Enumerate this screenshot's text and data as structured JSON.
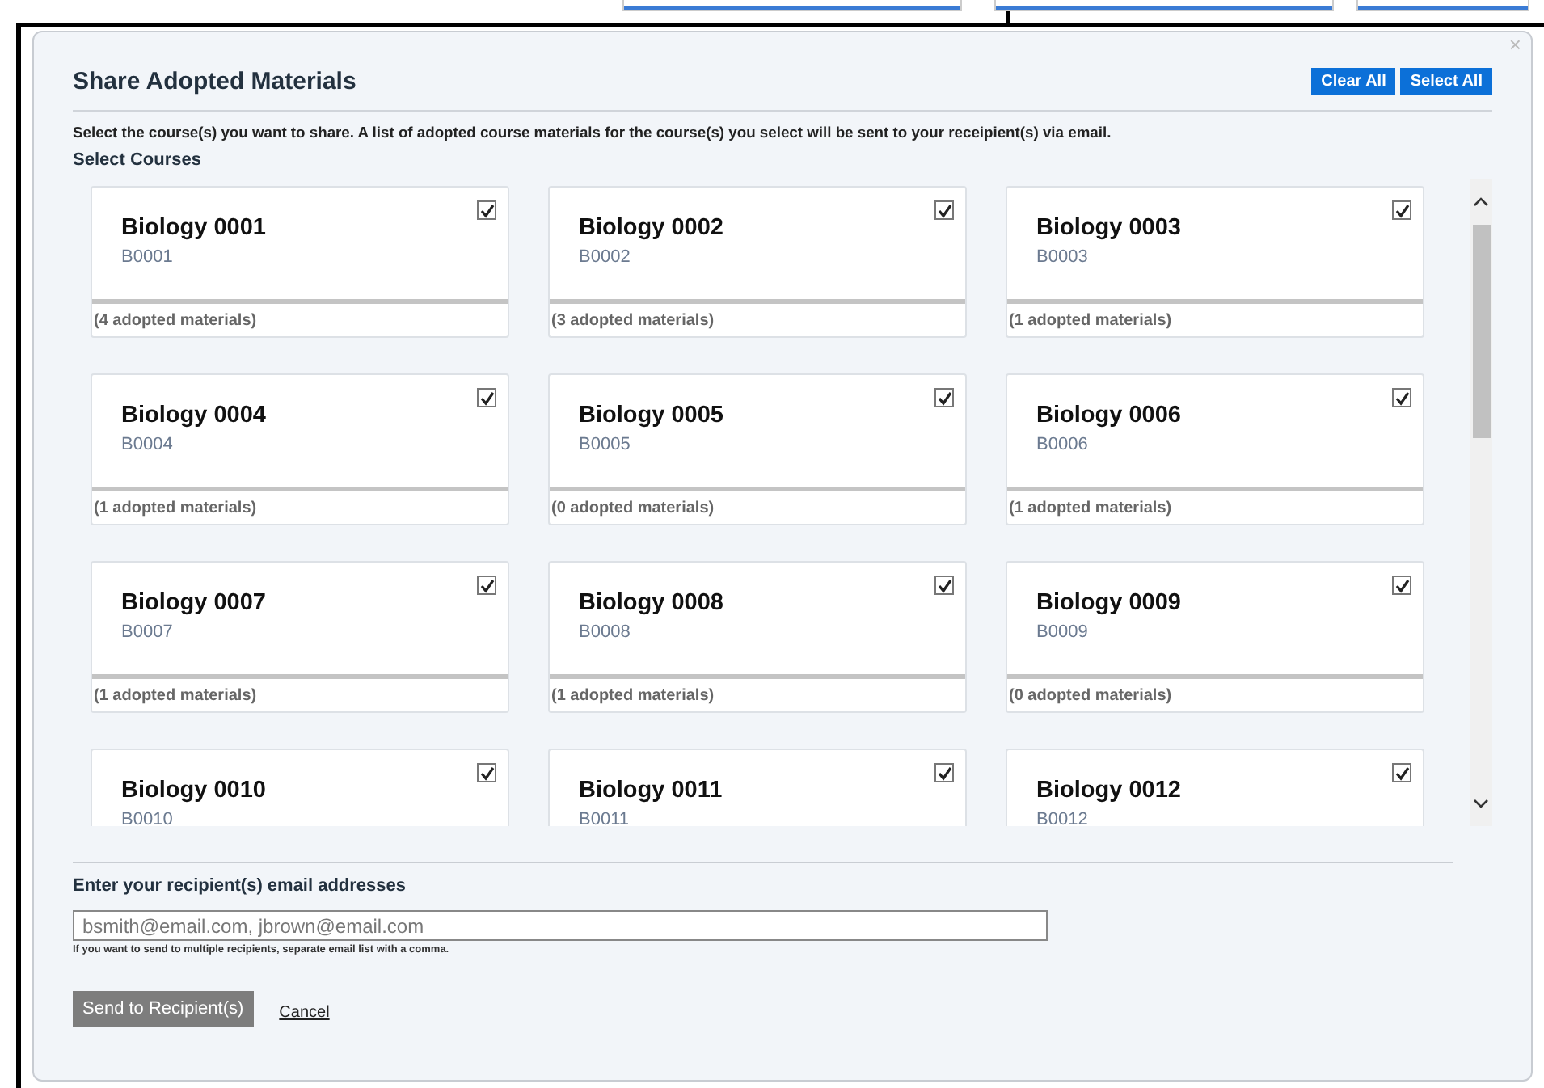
{
  "dialog": {
    "title": "Share Adopted Materials",
    "close": "×",
    "actions": [
      {
        "label": "Clear All"
      },
      {
        "label": "Select All"
      }
    ],
    "instructions": "Select the course(s) you want to share. A list of adopted course materials for the course(s) you select will be sent to your receipient(s) via email.",
    "section_label": "Select Courses",
    "courses": [
      {
        "title": "Biology 0001",
        "code": "B0001",
        "checked": true,
        "materials": "(4 adopted materials)"
      },
      {
        "title": "Biology 0002",
        "code": "B0002",
        "checked": true,
        "materials": "(3 adopted materials)"
      },
      {
        "title": "Biology 0003",
        "code": "B0003",
        "checked": true,
        "materials": "(1 adopted materials)"
      },
      {
        "title": "Biology 0004",
        "code": "B0004",
        "checked": true,
        "materials": "(1 adopted materials)"
      },
      {
        "title": "Biology 0005",
        "code": "B0005",
        "checked": true,
        "materials": "(0 adopted materials)"
      },
      {
        "title": "Biology 0006",
        "code": "B0006",
        "checked": true,
        "materials": "(1 adopted materials)"
      },
      {
        "title": "Biology 0007",
        "code": "B0007",
        "checked": true,
        "materials": "(1 adopted materials)"
      },
      {
        "title": "Biology 0008",
        "code": "B0008",
        "checked": true,
        "materials": "(1 adopted materials)"
      },
      {
        "title": "Biology 0009",
        "code": "B0009",
        "checked": true,
        "materials": "(0 adopted materials)"
      },
      {
        "title": "Biology 0010",
        "code": "B0010",
        "checked": true
      },
      {
        "title": "Biology 0011",
        "code": "B0011",
        "checked": true
      },
      {
        "title": "Biology 0012",
        "code": "B0012",
        "checked": true
      }
    ],
    "email_label": "Enter your recipient(s) email addresses",
    "email_placeholder": "bsmith@email.com, jbrown@email.com",
    "email_hint": "If you want to send to multiple recipients, separate email list with a comma.",
    "send_button": {
      "label": "Send to Recipient(s)",
      "disabled": true
    },
    "cancel_link": "Cancel"
  }
}
